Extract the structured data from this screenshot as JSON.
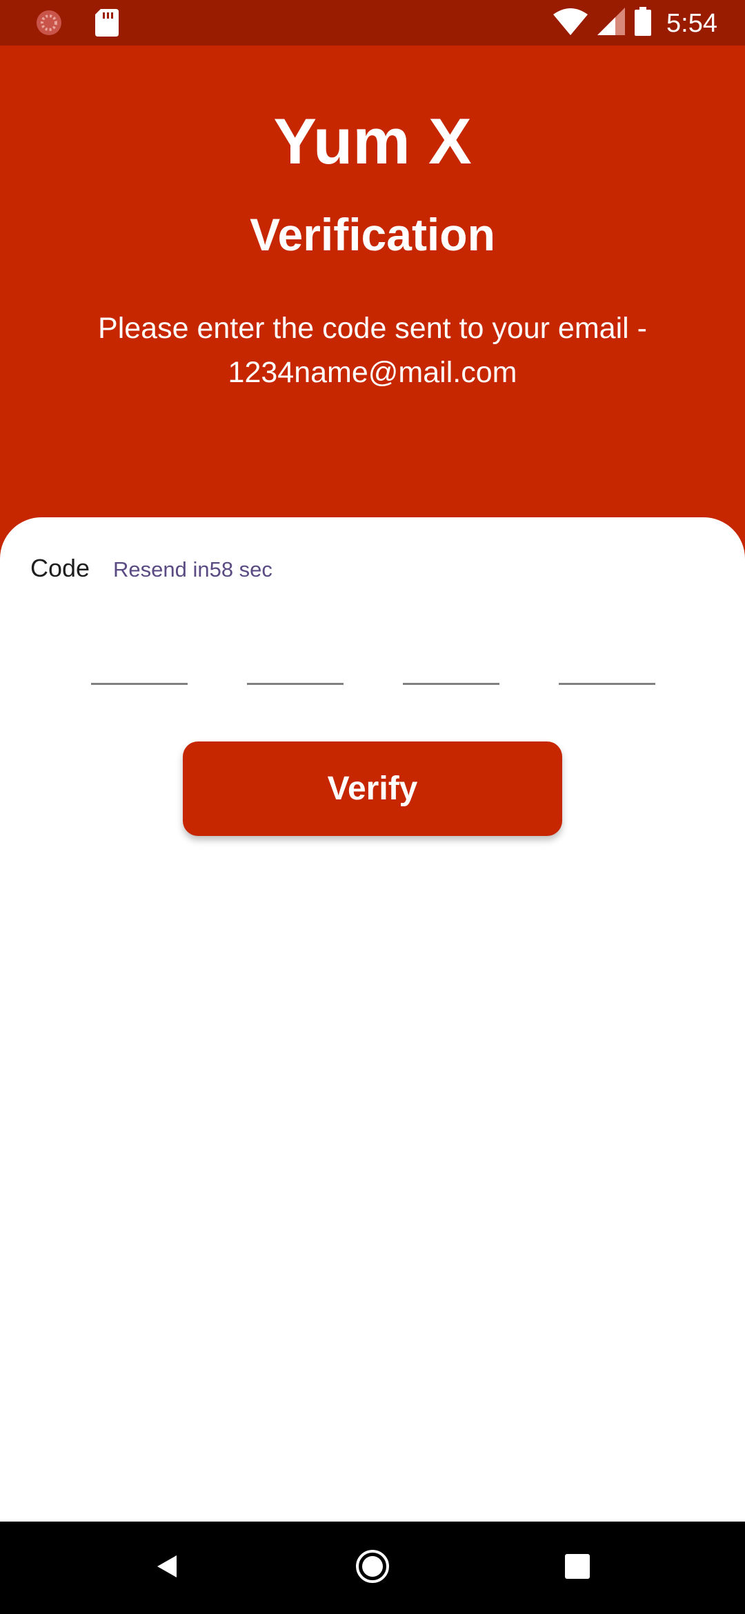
{
  "status_bar": {
    "time": "5:54",
    "left_icons": [
      "loading-indicator-icon",
      "sd-card-icon"
    ],
    "right_icons": [
      "wifi-icon",
      "cellular-signal-icon",
      "battery-icon"
    ]
  },
  "header": {
    "app_title": "Yum X",
    "page_title": "Verification",
    "instruction_line1": "Please enter the code sent to your email -",
    "instruction_line2": "1234name@mail.com"
  },
  "form": {
    "code_label": "Code",
    "resend_text": "Resend in58 sec",
    "code_slots": [
      "",
      "",
      "",
      ""
    ],
    "verify_label": "Verify"
  },
  "nav_bar": {
    "icons": [
      "back-icon",
      "home-icon",
      "recents-icon"
    ]
  },
  "colors": {
    "status_bar": "#9a1c00",
    "accent": "#c72700",
    "resend_text": "#5a4b83"
  }
}
